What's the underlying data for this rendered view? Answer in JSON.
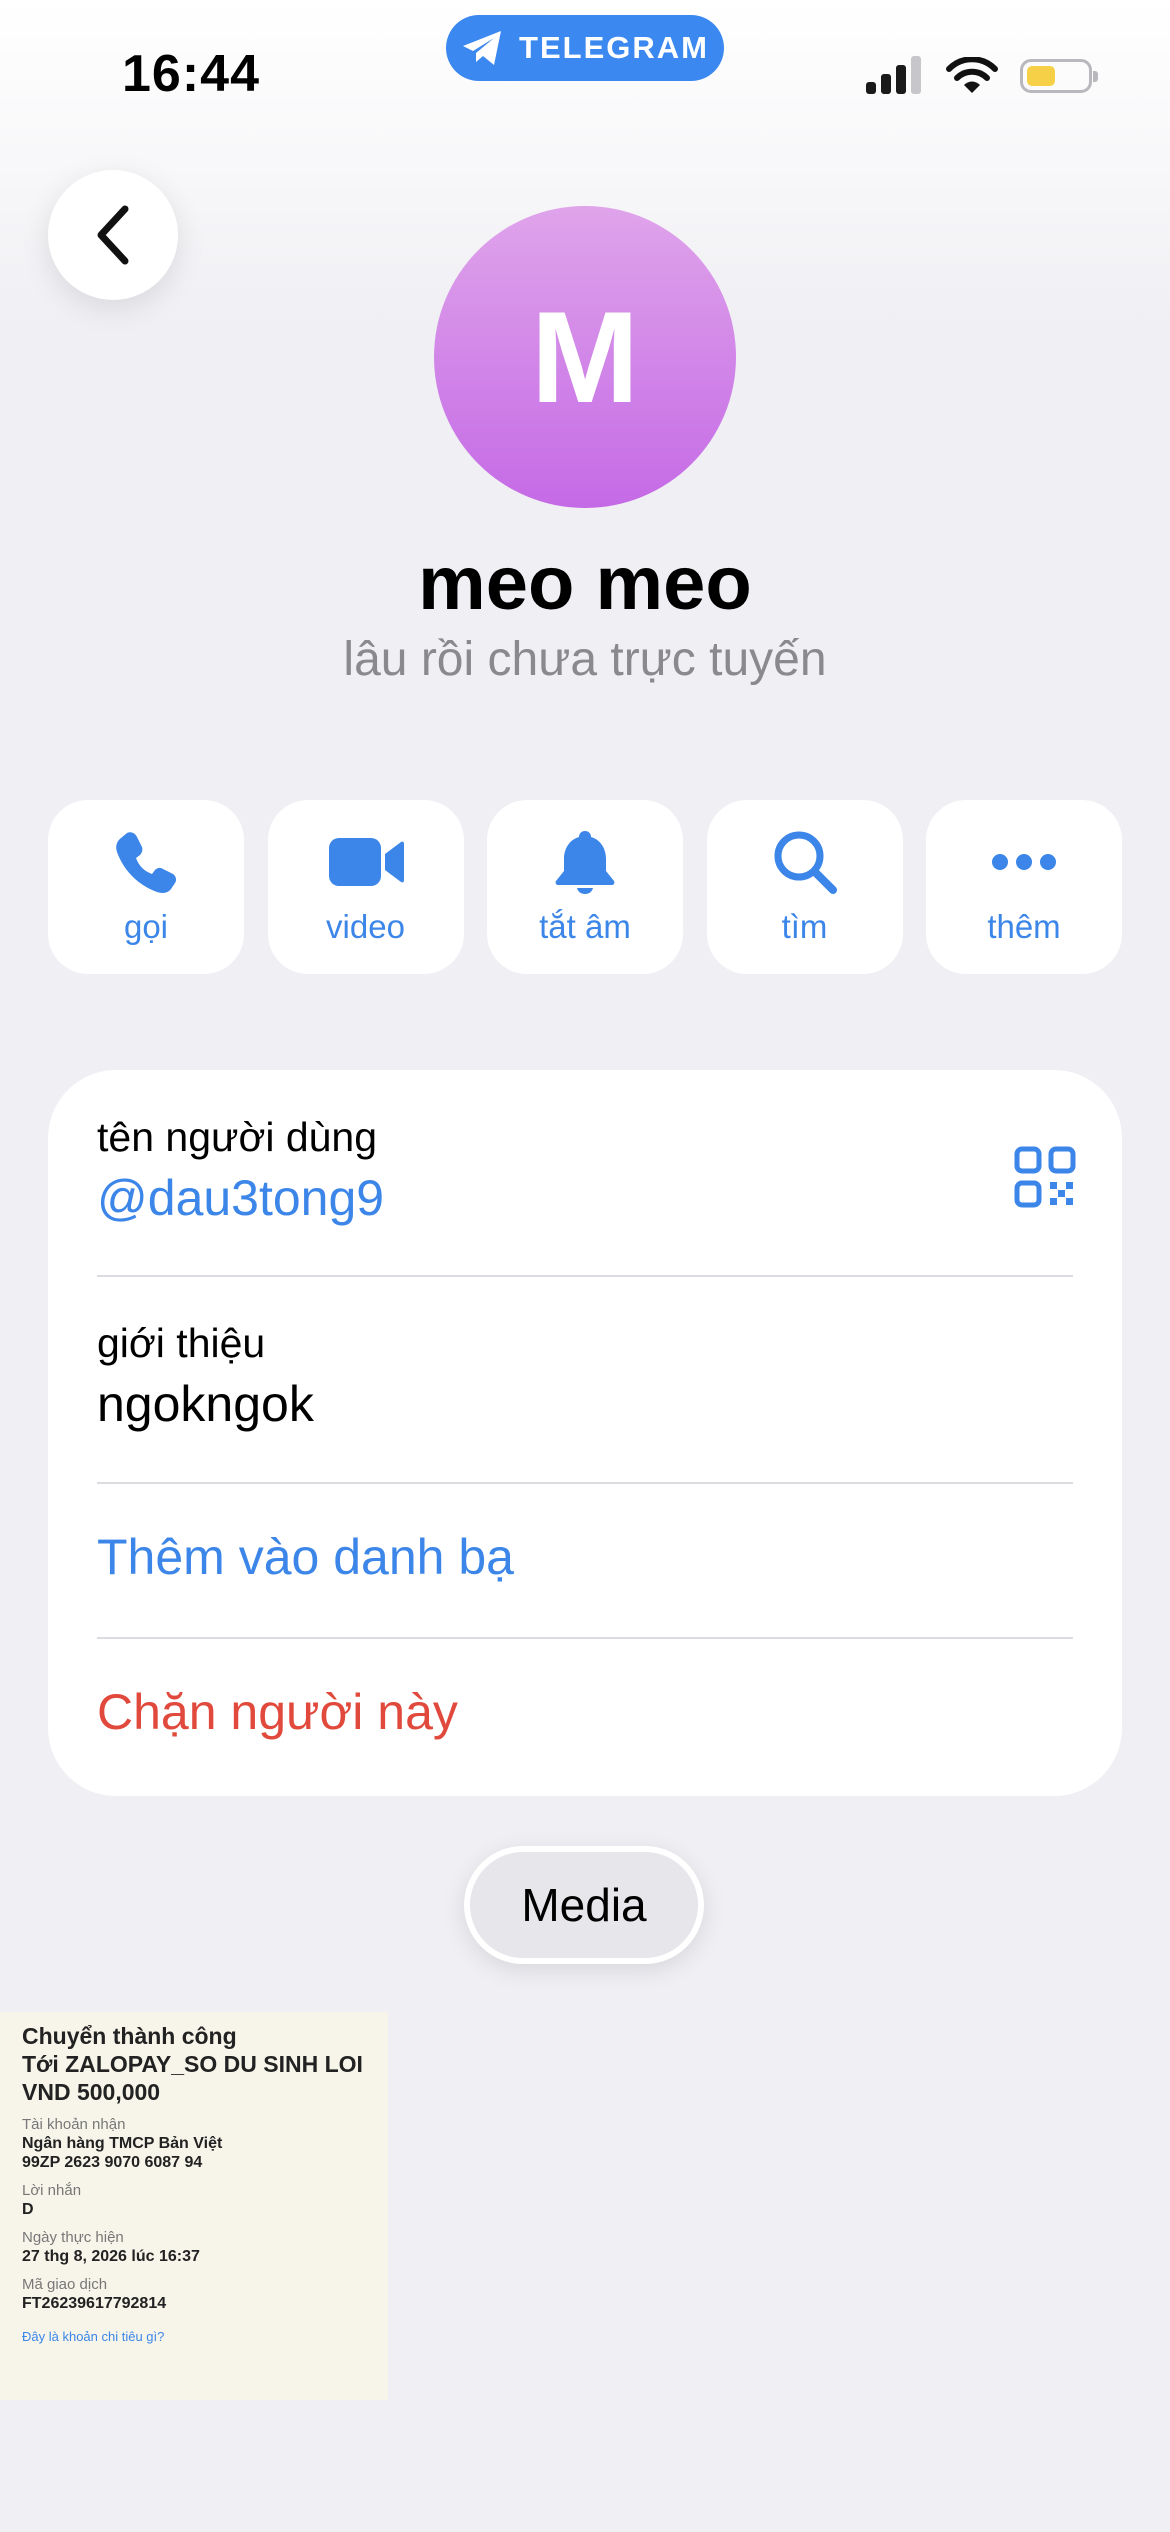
{
  "status_bar": {
    "time": "16:44",
    "app_pill": "TELEGRAM",
    "battery_color": "#f6d046"
  },
  "profile": {
    "avatar_letter": "M",
    "avatar_gradient": [
      "#dfa4ea",
      "#c56ae6"
    ],
    "name": "meo meo",
    "last_seen": "lâu rồi chưa trực tuyến"
  },
  "actions": [
    {
      "label": "gọi",
      "icon": "phone-icon"
    },
    {
      "label": "video",
      "icon": "video-camera-icon"
    },
    {
      "label": "tắt âm",
      "icon": "bell-icon"
    },
    {
      "label": "tìm",
      "icon": "search-icon"
    },
    {
      "label": "thêm",
      "icon": "more-dots-icon"
    }
  ],
  "info": {
    "username_label": "tên người dùng",
    "username_value": "@dau3tong9",
    "bio_label": "giới thiệu",
    "bio_value": "ngokngok",
    "add_contact": "Thêm vào danh bạ",
    "block_user": "Chặn người này"
  },
  "tabs": {
    "media": "Media"
  },
  "media_item": {
    "title_lines": [
      "Chuyển thành công",
      "Tới ZALOPAY_SO DU SINH LOI",
      "VND 500,000"
    ],
    "fields": [
      {
        "label": "Tài khoản nhận",
        "value": [
          "Ngân hàng TMCP Bản Việt",
          "99ZP 2623 9070 6087 94"
        ]
      },
      {
        "label": "Lời nhắn",
        "value": [
          "D"
        ]
      },
      {
        "label": "Ngày thực hiện",
        "value": [
          "27 thg 8, 2026 lúc 16:37"
        ]
      },
      {
        "label": "Mã giao dịch",
        "value": [
          "FT26239617792814"
        ]
      }
    ],
    "footer_link": "Đây là khoản chi tiêu gì?"
  },
  "colors": {
    "accent": "#3b86e8",
    "destructive": "#e0493b",
    "background": "#efeff4"
  }
}
